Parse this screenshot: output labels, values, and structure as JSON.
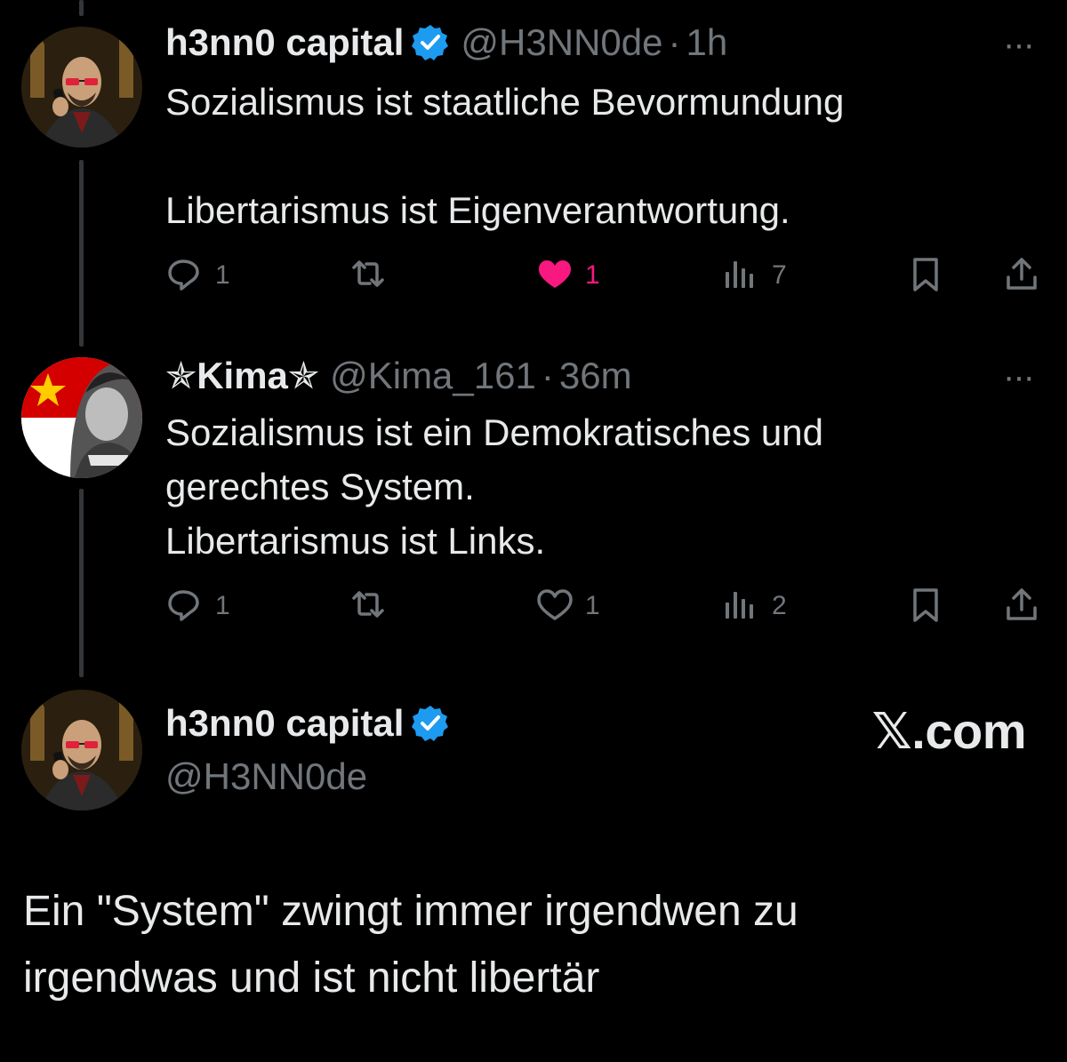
{
  "tweet1": {
    "display_name": "h3nn0 capital",
    "handle": "@H3NN0de",
    "time": "1h",
    "separator": "·",
    "text": "Sozialismus ist staatliche Bevormundung\n\nLibertarismus ist Eigenverantwortung.",
    "replies": "1",
    "likes": "1",
    "views": "7",
    "liked": true
  },
  "tweet2": {
    "display_name": "✯Kima✯",
    "handle": "@Kima_161",
    "time": "36m",
    "separator": "·",
    "text": "Sozialismus ist ein Demokratisches und\ngerechtes System.\nLibertarismus ist Links.",
    "replies": "1",
    "likes": "1",
    "views": "2",
    "liked": false
  },
  "main_tweet": {
    "display_name": "h3nn0 capital",
    "handle": "@H3NN0de",
    "text": "Ein \"System\" zwingt immer irgendwen zu\nirgendwas und ist nicht libertär"
  },
  "watermark": "𝕏.com",
  "more_glyph": "···",
  "colors": {
    "background": "#000000",
    "text_primary": "#e7e9ea",
    "text_secondary": "#71767b",
    "verified": "#1d9bf0",
    "like_active": "#f91880",
    "thread_line": "#333639"
  },
  "icons": [
    "reply-icon",
    "retweet-icon",
    "like-icon",
    "views-icon",
    "bookmark-icon",
    "share-icon",
    "verified-badge-icon",
    "more-icon"
  ]
}
